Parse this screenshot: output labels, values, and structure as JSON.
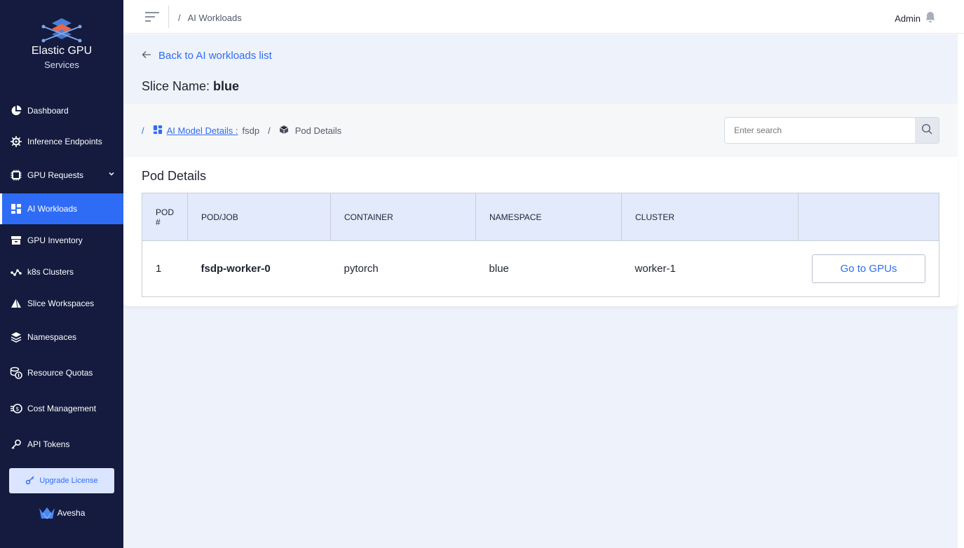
{
  "brand": {
    "title": "Elastic GPU",
    "subtitle": "Services"
  },
  "sidebar": {
    "items": [
      {
        "label": "Dashboard",
        "icon": "pie-chart-icon"
      },
      {
        "label": "Inference Endpoints",
        "icon": "cog-chip-icon"
      },
      {
        "label": "GPU Requests",
        "icon": "chip-icon"
      },
      {
        "label": "AI Workloads",
        "icon": "grid-icon",
        "active": true
      },
      {
        "label": "GPU Inventory",
        "icon": "archive-icon"
      },
      {
        "label": "k8s Clusters",
        "icon": "nodes-icon"
      },
      {
        "label": "Slice Workspaces",
        "icon": "pyramid-icon"
      },
      {
        "label": "Namespaces",
        "icon": "layers-icon"
      },
      {
        "label": "Resource Quotas",
        "icon": "coins-icon"
      },
      {
        "label": "Cost Management",
        "icon": "money-icon"
      },
      {
        "label": "API Tokens",
        "icon": "key-icon"
      }
    ],
    "upgrade_label": "Upgrade License",
    "footer_brand": "Avesha"
  },
  "topbar": {
    "breadcrumb": "AI Workloads",
    "user": "Admin"
  },
  "main": {
    "back_label": "Back to AI workloads list",
    "slice_label": "Slice Name:",
    "slice_name": "blue",
    "crumb": {
      "model_link": "AI Model Details :",
      "model_value": "fsdp",
      "current": "Pod Details"
    },
    "search_placeholder": "Enter search",
    "section_title": "Pod Details",
    "table": {
      "headers": [
        "POD #",
        "POD/JOB",
        "CONTAINER",
        "NAMESPACE",
        "CLUSTER",
        ""
      ],
      "rows": [
        {
          "index": "1",
          "pod": "fsdp-worker-0",
          "container": "pytorch",
          "namespace": "blue",
          "cluster": "worker-1",
          "action": "Go to GPUs"
        }
      ]
    }
  },
  "colors": {
    "sidebar_bg": "#141b3f",
    "accent": "#2f6cf6",
    "table_header_bg": "#e2eafc"
  }
}
